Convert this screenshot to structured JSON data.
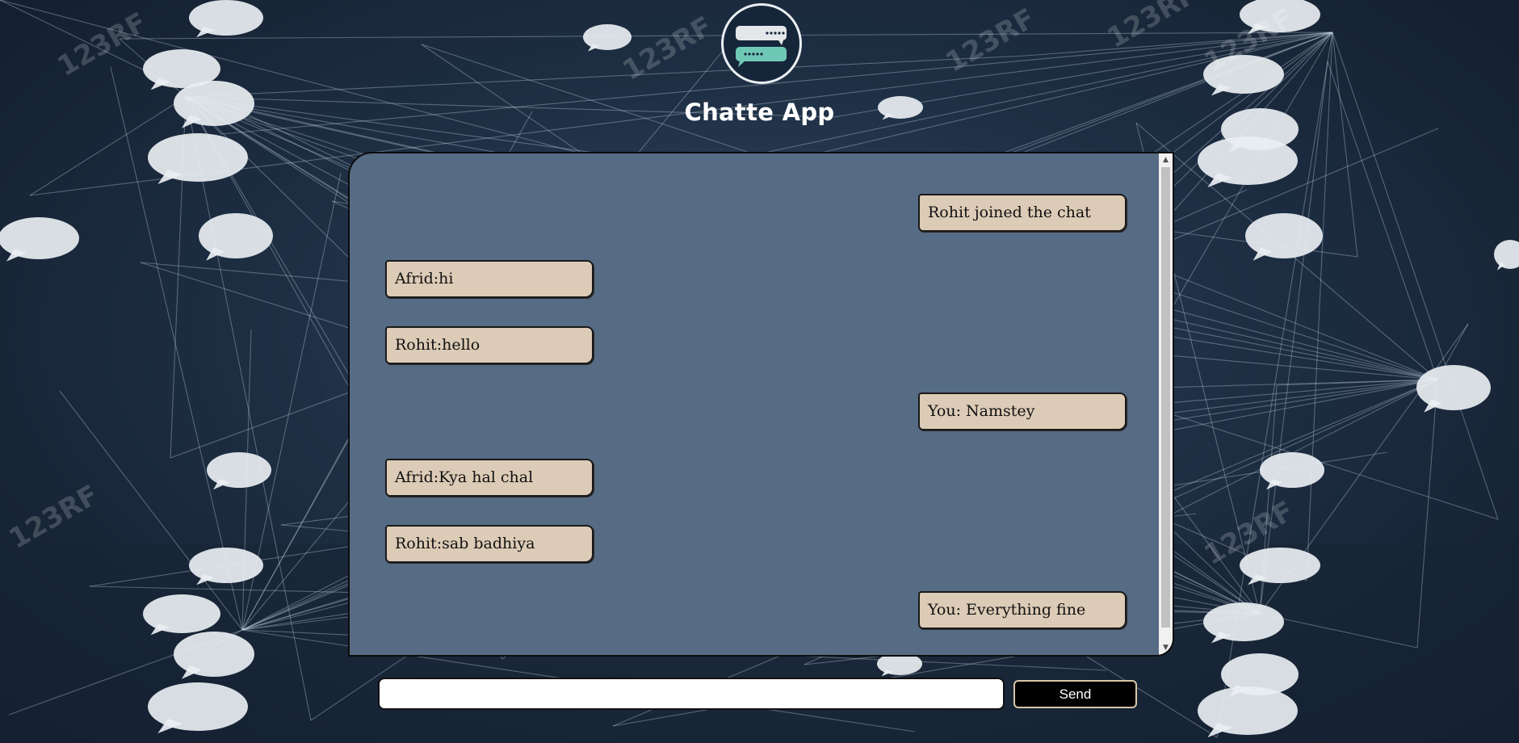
{
  "app": {
    "title": "Chatte App"
  },
  "messages": [
    {
      "text": "Rohit joined the chat",
      "side": "right"
    },
    {
      "text": "Afrid:hi",
      "side": "left"
    },
    {
      "text": "Rohit:hello",
      "side": "left"
    },
    {
      "text": "You: Namstey",
      "side": "right"
    },
    {
      "text": "Afrid:Kya hal chal",
      "side": "left"
    },
    {
      "text": "Rohit:sab badhiya",
      "side": "left"
    },
    {
      "text": "You: Everything fine",
      "side": "right"
    }
  ],
  "composer": {
    "input_value": "",
    "send_label": "Send"
  },
  "background": {
    "watermark": "123RF"
  },
  "colors": {
    "panel": "#566b84",
    "bubble": "#dccbb6",
    "send_button": "#000000",
    "logo_green": "#6fc8b6"
  },
  "icons": {
    "logo": "chat-bubbles-icon",
    "scroll_up": "arrow-up-icon",
    "scroll_down": "arrow-down-icon"
  }
}
